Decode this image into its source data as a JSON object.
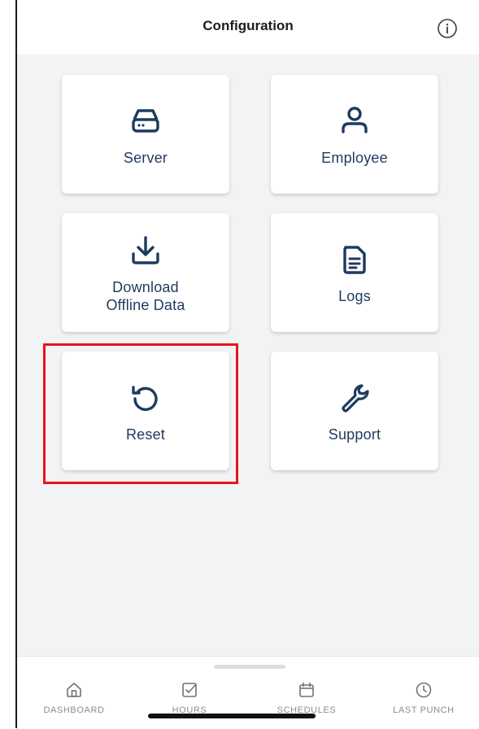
{
  "header": {
    "title": "Configuration",
    "info_icon": "info-circle-icon"
  },
  "tiles": [
    {
      "label": "Server",
      "icon": "server-drive-icon"
    },
    {
      "label": "Employee",
      "icon": "user-icon"
    },
    {
      "label": "Download\nOffline Data",
      "icon": "download-icon"
    },
    {
      "label": "Logs",
      "icon": "document-icon"
    },
    {
      "label": "Reset",
      "icon": "reset-icon"
    },
    {
      "label": "Support",
      "icon": "wrench-icon"
    }
  ],
  "tabbar": {
    "tabs": [
      {
        "label": "DASHBOARD",
        "icon": "home-icon"
      },
      {
        "label": "HOURS",
        "icon": "checkbox-icon"
      },
      {
        "label": "SCHEDULES",
        "icon": "calendar-icon"
      },
      {
        "label": "LAST PUNCH",
        "icon": "clock-icon"
      }
    ]
  },
  "colors": {
    "accent": "#1e3a5f",
    "highlight": "#e8151b",
    "background": "#f2f3f5",
    "tab_inactive": "#8a8d93"
  }
}
